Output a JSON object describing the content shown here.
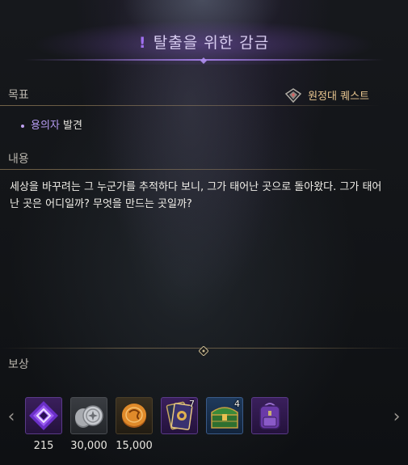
{
  "title": {
    "text": "탈출을 위한 감금"
  },
  "objective": {
    "label": "목표",
    "quest_type": "원정대 퀘스트",
    "items": [
      {
        "highlight": "용의자",
        "rest": " 발견"
      }
    ]
  },
  "content": {
    "label": "내용",
    "text": "세상을 바꾸려는 그 누군가를 추적하다 보니, 그가 태어난 곳으로 돌아왔다. 그가 태어난 곳은 어디일까? 무엇을 만드는 곳일까?"
  },
  "rewards": {
    "label": "보상",
    "items": [
      {
        "icon": "purple-gem-icon",
        "amount": "215",
        "count": ""
      },
      {
        "icon": "silver-coins-icon",
        "amount": "30,000",
        "count": ""
      },
      {
        "icon": "gold-coin-icon",
        "amount": "15,000",
        "count": ""
      },
      {
        "icon": "card-pack-icon",
        "amount": "",
        "count": "7"
      },
      {
        "icon": "treasure-chest-icon",
        "amount": "",
        "count": "4"
      },
      {
        "icon": "purple-backpack-icon",
        "amount": "",
        "count": ""
      }
    ]
  },
  "colors": {
    "accent_purple": "#a070f0",
    "gold_text": "#e8c690",
    "highlight": "#b79cf5"
  }
}
